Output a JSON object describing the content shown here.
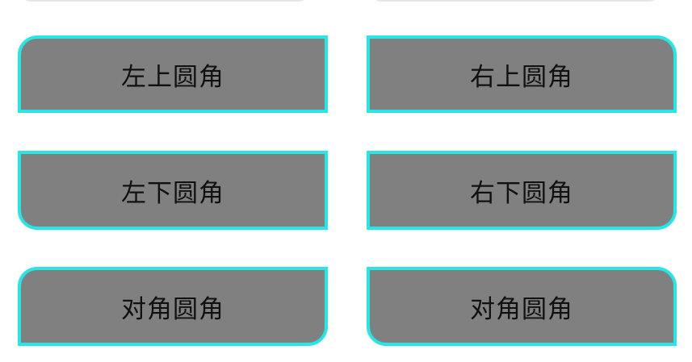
{
  "buttons": {
    "top_left_label": "左上圆角",
    "top_right_label": "右上圆角",
    "bottom_left_label": "左下圆角",
    "bottom_right_label": "右下圆角",
    "diagonal_1_label": "对角圆角",
    "diagonal_2_label": "对角圆角"
  },
  "colors": {
    "button_fill": "#808080",
    "button_border": "#26e6e6",
    "label_text": "#111111",
    "background": "#ffffff"
  }
}
